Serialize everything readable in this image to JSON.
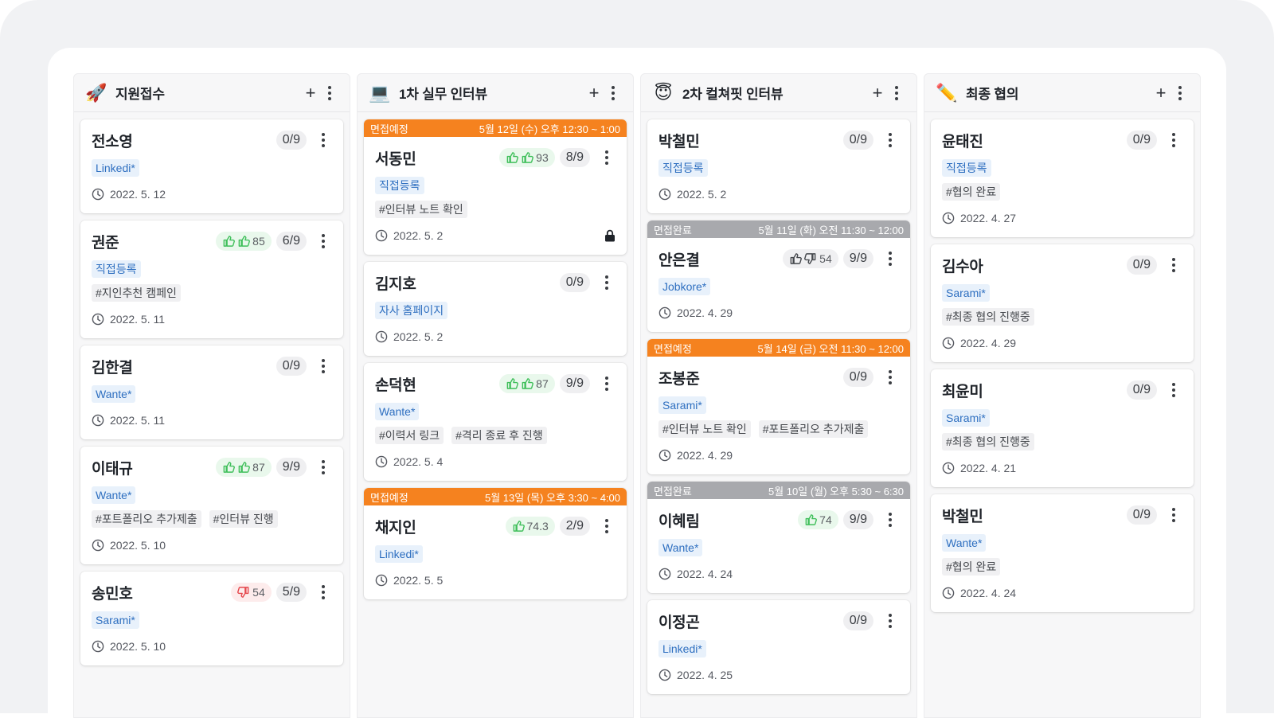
{
  "columns": [
    {
      "emoji": "🚀",
      "emoji_name": "rocket-icon",
      "title": "지원접수",
      "cards": [
        {
          "name": "전소영",
          "score": "0/9",
          "tags": [
            [
              "Linkedi*",
              "src"
            ]
          ],
          "date": "2022. 5. 12"
        },
        {
          "name": "권준",
          "rating": {
            "icons": [
              "up",
              "up"
            ],
            "value": "85",
            "kind": "good"
          },
          "score": "6/9",
          "tags": [
            [
              "직접등록",
              "src"
            ]
          ],
          "tags2": [
            [
              "#지인추천 캠페인",
              "memo"
            ]
          ],
          "date": "2022. 5. 11"
        },
        {
          "name": "김한결",
          "score": "0/9",
          "tags": [
            [
              "Wante*",
              "src"
            ]
          ],
          "date": "2022. 5. 11"
        },
        {
          "name": "이태규",
          "rating": {
            "icons": [
              "up",
              "up"
            ],
            "value": "87",
            "kind": "good"
          },
          "score": "9/9",
          "tags": [
            [
              "Wante*",
              "src"
            ]
          ],
          "tags2": [
            [
              "#포트폴리오 추가제출",
              "memo"
            ],
            [
              "#인터뷰 진행",
              "memo"
            ]
          ],
          "date": "2022. 5. 10"
        },
        {
          "name": "송민호",
          "rating": {
            "icons": [
              "down"
            ],
            "value": "54",
            "kind": "bad"
          },
          "score": "5/9",
          "tags": [
            [
              "Sarami*",
              "src"
            ]
          ],
          "date": "2022. 5. 10"
        }
      ]
    },
    {
      "emoji": "💻",
      "emoji_name": "laptop-icon",
      "title": "1차 실무 인터뷰",
      "cards": [
        {
          "banner": {
            "label": "면접예정",
            "time": "5월 12일 (수) 오후 12:30 ~ 1:00",
            "kind": "orange"
          },
          "name": "서동민",
          "rating": {
            "icons": [
              "up",
              "up"
            ],
            "value": "93",
            "kind": "good"
          },
          "score": "8/9",
          "tags": [
            [
              "직접등록",
              "src"
            ]
          ],
          "tags2": [
            [
              "#인터뷰 노트 확인",
              "memo"
            ]
          ],
          "date": "2022. 5. 2",
          "locked": true
        },
        {
          "name": "김지호",
          "score": "0/9",
          "tags": [
            [
              "자사 홈페이지",
              "src"
            ]
          ],
          "date": "2022. 5. 2"
        },
        {
          "name": "손덕현",
          "rating": {
            "icons": [
              "up",
              "up"
            ],
            "value": "87",
            "kind": "good"
          },
          "score": "9/9",
          "tags": [
            [
              "Wante*",
              "src"
            ]
          ],
          "tags2": [
            [
              "#이력서 링크",
              "memo"
            ],
            [
              "#격리 종료 후 진행",
              "memo"
            ]
          ],
          "date": "2022. 5. 4"
        },
        {
          "banner": {
            "label": "면접예정",
            "time": "5월 13일 (목) 오후 3:30 ~ 4:00",
            "kind": "orange"
          },
          "name": "채지인",
          "rating": {
            "icons": [
              "up"
            ],
            "value": "74.3",
            "kind": "good"
          },
          "score": "2/9",
          "tags": [
            [
              "Linkedi*",
              "src"
            ]
          ],
          "date": "2022. 5. 5"
        }
      ]
    },
    {
      "emoji": "😇",
      "emoji_name": "angel-face-icon",
      "title": "2차 컬쳐핏 인터뷰",
      "cards": [
        {
          "name": "박철민",
          "score": "0/9",
          "tags": [
            [
              "직접등록",
              "src"
            ]
          ],
          "date": "2022. 5. 2"
        },
        {
          "banner": {
            "label": "면접완료",
            "time": "5월 11일 (화) 오전 11:30 ~ 12:00",
            "kind": "gray"
          },
          "name": "안은결",
          "rating": {
            "icons": [
              "up-dark",
              "down-dark"
            ],
            "value": "54",
            "kind": "mixed"
          },
          "score": "9/9",
          "tags": [
            [
              "Jobkore*",
              "src"
            ]
          ],
          "date": "2022. 4. 29"
        },
        {
          "banner": {
            "label": "면접예정",
            "time": "5월 14일 (금) 오전 11:30 ~ 12:00",
            "kind": "orange"
          },
          "name": "조봉준",
          "score": "0/9",
          "tags": [
            [
              "Sarami*",
              "src"
            ]
          ],
          "tags2": [
            [
              "#인터뷰 노트 확인",
              "memo"
            ],
            [
              "#포트폴리오 추가제출",
              "memo"
            ]
          ],
          "date": "2022. 4. 29"
        },
        {
          "banner": {
            "label": "면접완료",
            "time": "5월 10일 (월) 오후 5:30 ~ 6:30",
            "kind": "gray"
          },
          "name": "이혜림",
          "rating": {
            "icons": [
              "up"
            ],
            "value": "74",
            "kind": "good"
          },
          "score": "9/9",
          "tags": [
            [
              "Wante*",
              "src"
            ]
          ],
          "date": "2022. 4. 24"
        },
        {
          "name": "이정곤",
          "score": "0/9",
          "tags": [
            [
              "Linkedi*",
              "src"
            ]
          ],
          "date": "2022. 4. 25"
        }
      ]
    },
    {
      "emoji": "✏️",
      "emoji_name": "pencil-icon",
      "title": "최종 협의",
      "cards": [
        {
          "name": "윤태진",
          "score": "0/9",
          "tags": [
            [
              "직접등록",
              "src"
            ]
          ],
          "tags2": [
            [
              "#협의 완료",
              "memo"
            ]
          ],
          "date": "2022. 4. 27"
        },
        {
          "name": "김수아",
          "score": "0/9",
          "tags": [
            [
              "Sarami*",
              "src"
            ]
          ],
          "tags2": [
            [
              "#최종 협의 진행중",
              "memo"
            ]
          ],
          "date": "2022. 4. 29"
        },
        {
          "name": "최윤미",
          "score": "0/9",
          "tags": [
            [
              "Sarami*",
              "src"
            ]
          ],
          "tags2": [
            [
              "#최종 협의 진행중",
              "memo"
            ]
          ],
          "date": "2022. 4. 21"
        },
        {
          "name": "박철민",
          "score": "0/9",
          "tags": [
            [
              "Wante*",
              "src"
            ]
          ],
          "tags2": [
            [
              "#협의 완료",
              "memo"
            ]
          ],
          "date": "2022. 4. 24"
        }
      ]
    }
  ],
  "colors": {
    "accent_orange": "#f5821f",
    "done_gray": "#a8a9ad",
    "thumb_green": "#3fbf5a",
    "thumb_red": "#e5484d",
    "source_blue": "#2e6fc0"
  }
}
